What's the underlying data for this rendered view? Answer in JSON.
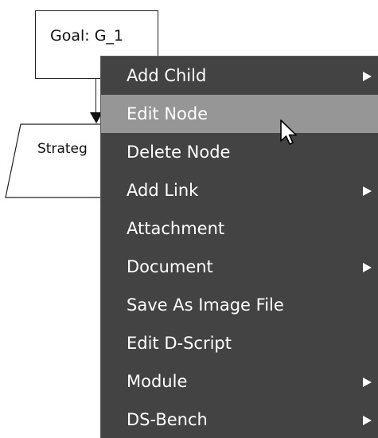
{
  "diagram": {
    "goal_node": {
      "label": "Goal: G_1"
    },
    "strategy_node": {
      "label": "Strateg"
    }
  },
  "context_menu": {
    "items": [
      {
        "label": "Add Child",
        "has_submenu": true,
        "highlighted": false
      },
      {
        "label": "Edit Node",
        "has_submenu": false,
        "highlighted": true
      },
      {
        "label": "Delete Node",
        "has_submenu": false,
        "highlighted": false
      },
      {
        "label": "Add Link",
        "has_submenu": true,
        "highlighted": false
      },
      {
        "label": "Attachment",
        "has_submenu": false,
        "highlighted": false
      },
      {
        "label": "Document",
        "has_submenu": true,
        "highlighted": false
      },
      {
        "label": "Save As Image File",
        "has_submenu": false,
        "highlighted": false
      },
      {
        "label": "Edit D-Script",
        "has_submenu": false,
        "highlighted": false
      },
      {
        "label": "Module",
        "has_submenu": true,
        "highlighted": false
      },
      {
        "label": "DS-Bench",
        "has_submenu": true,
        "highlighted": false
      }
    ]
  },
  "colors": {
    "menu_background": "#434343",
    "menu_highlight": "#969696",
    "menu_text": "#ffffff",
    "node_border": "#222222"
  },
  "icons": {
    "pointer": "mouse-pointer-icon",
    "submenu": "submenu-arrow-icon"
  }
}
